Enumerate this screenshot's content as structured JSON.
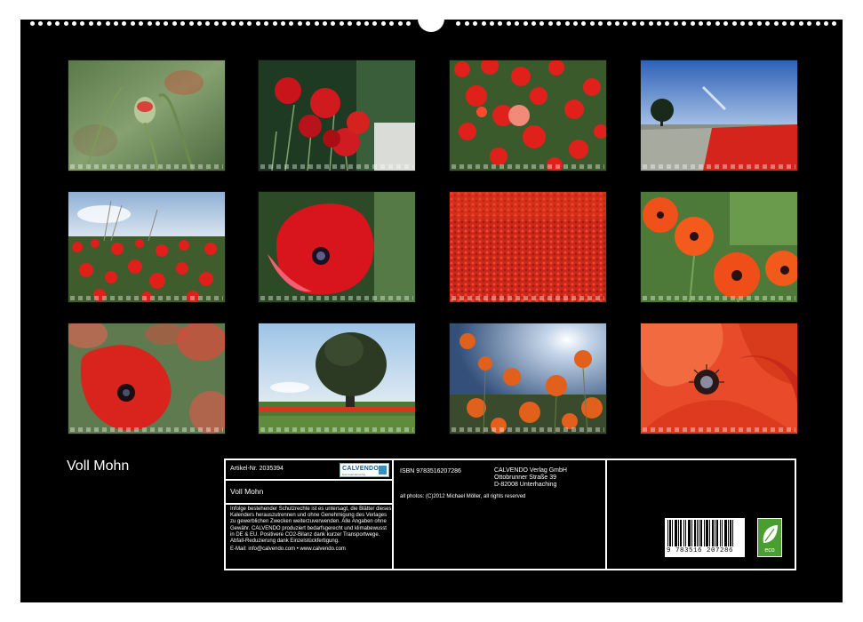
{
  "calendar": {
    "title": "Voll Mohn",
    "photos": [
      {
        "name": "poppy-bud"
      },
      {
        "name": "red-poppies-cluster"
      },
      {
        "name": "poppy-field-closeup"
      },
      {
        "name": "tree-and-poppy-field"
      },
      {
        "name": "poppy-meadow-sky"
      },
      {
        "name": "single-red-poppy"
      },
      {
        "name": "vast-poppy-field"
      },
      {
        "name": "orange-poppies"
      },
      {
        "name": "poppies-blurred"
      },
      {
        "name": "lone-tree"
      },
      {
        "name": "poppies-against-sun"
      },
      {
        "name": "poppy-macro"
      }
    ]
  },
  "info": {
    "article_number": "Artikel-Nr. 2035394",
    "product_title": "Voll Mohn",
    "calvendo_logo": "CALVENDO",
    "calvendo_logo_sub": "Das Kalenderverlag",
    "legal_text": "Infolge bestehender Schutzrechte ist es untersagt, die Blätter dieses Kalenders herauszutrennen und ohne Genehmigung des Verlages zu gewerblichen Zwecken weiterzuverwenden. Alle Angaben ohne Gewähr. CALVENDO produziert bedarfsgerecht und klimabewusst in DE & EU. Positivere CO2-Bilanz dank kurzer Transportwege. Abfall-Reduzierung dank Einzelstückfertigung.",
    "contact": "E-Mail: info@calvendo.com • www.calvendo.com",
    "isbn": "ISBN 9783516207286",
    "publisher_name": "CALVENDO Verlag GmbH",
    "publisher_street": "Ottobrunner Straße 39",
    "publisher_city": "D-82008 Unterhaching",
    "photo_credit": "all photos: (C)2012 Michael Möller, all rights reserved",
    "barcode_number": "9 783516 207286",
    "eco_label": "eco"
  }
}
